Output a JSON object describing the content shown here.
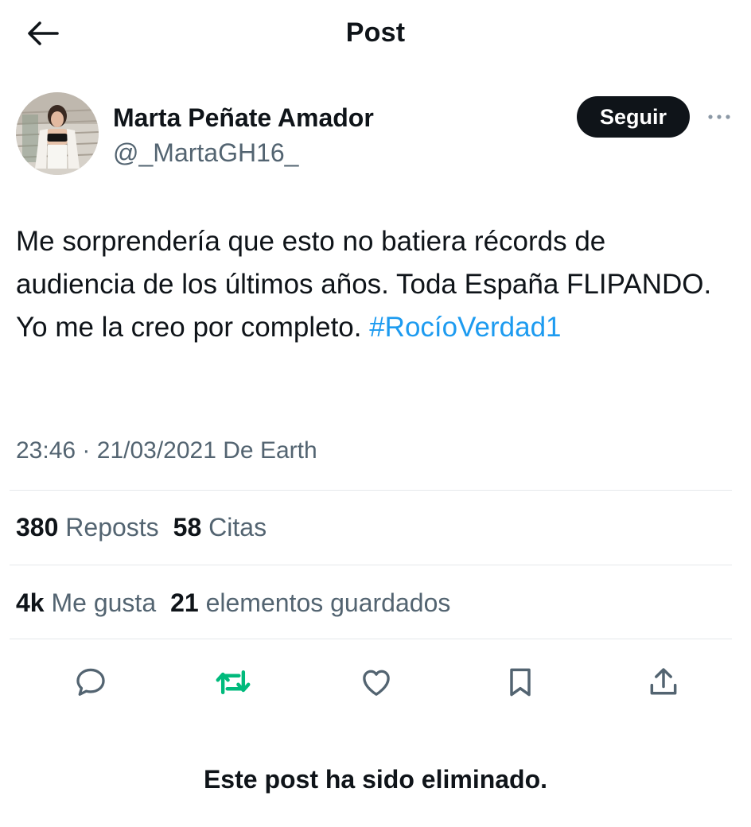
{
  "header": {
    "title": "Post",
    "back_icon": "arrow-left-icon"
  },
  "author": {
    "name": "Marta Peñate Amador",
    "handle": "@_MartaGH16_",
    "follow_label": "Seguir",
    "more_icon": "more-horizontal-icon"
  },
  "post": {
    "text": "Me sorprendería que esto no batiera récords de audiencia de los últimos años. Toda España FLIPANDO.\nYo me la creo por completo.  ",
    "hashtag": "#RocíoVerdad1",
    "time": "23:46",
    "separator": "·",
    "date": "21/03/2021",
    "source": "De Earth"
  },
  "stats": {
    "reposts_count": "380",
    "reposts_label": "Reposts",
    "quotes_count": "58",
    "quotes_label": "Citas",
    "likes_count": "4k",
    "likes_label": "Me gusta",
    "bookmarks_count": "21",
    "bookmarks_label": "elementos guardados"
  },
  "actions": [
    {
      "name": "reply",
      "icon": "comment-icon"
    },
    {
      "name": "repost",
      "icon": "repost-icon",
      "color": "#00ba7c"
    },
    {
      "name": "like",
      "icon": "heart-icon"
    },
    {
      "name": "bookmark",
      "icon": "bookmark-icon"
    },
    {
      "name": "share",
      "icon": "share-icon"
    }
  ],
  "notice": "Este post ha sido eliminado.",
  "colors": {
    "text": "#0f1419",
    "secondary": "#536471",
    "link": "#1d9bf0",
    "repost": "#00ba7c",
    "divider": "#e5e8eb"
  }
}
